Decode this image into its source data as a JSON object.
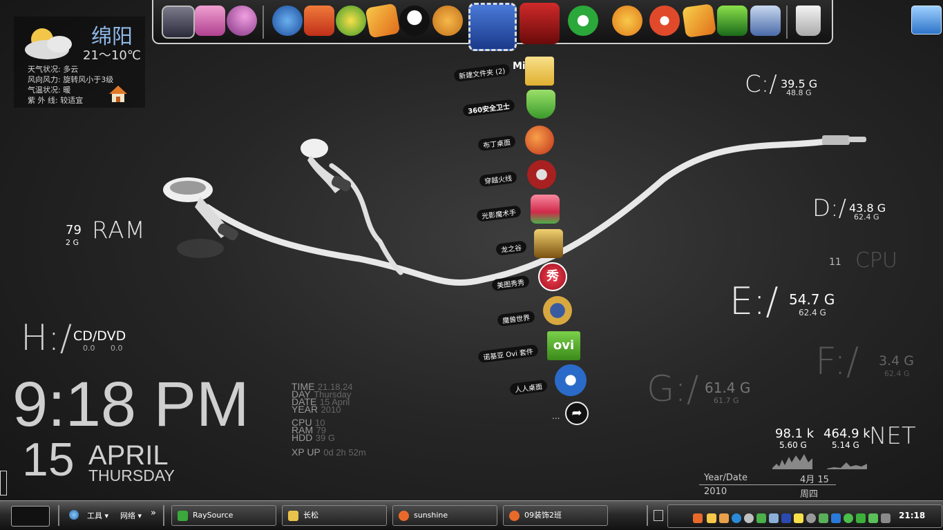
{
  "weather": {
    "city": "绵阳",
    "temp_range": "21～10℃",
    "lines": [
      "天气状况: 多云",
      "风向风力: 旋转风小于3级",
      "气温状况: 暖",
      "紫 外 线: 较适宜"
    ]
  },
  "dock": {
    "icons": [
      "monitor-icon",
      "folder-pink-icon",
      "monitor-ball-icon",
      "network-icon",
      "flash-icon",
      "music-green-icon",
      "music-box-icon",
      "qq-penguin-icon",
      "raccoon-icon",
      "film-strip-icon",
      "torii-gate-icon",
      "ie-browser-icon",
      "arrow-orange-icon",
      "player-red-icon",
      "music-box2-icon",
      "audio-wave-icon",
      "media-player-icon",
      "recycle-bin-icon"
    ],
    "top_label": "Mi...ing"
  },
  "menu": {
    "items": [
      {
        "label": "新建文件夹 (2)",
        "icon": "folder-icon",
        "color": "#e8c24a"
      },
      {
        "label": "360安全卫士",
        "icon": "shield-icon",
        "color": "#5ab53a"
      },
      {
        "label": "布丁桌面",
        "icon": "bird-icon",
        "color": "#d84a1c"
      },
      {
        "label": "穿越火线",
        "icon": "crossfire-icon",
        "color": "#a82020"
      },
      {
        "label": "光影魔术手",
        "icon": "photo-icon",
        "color": "#e05060"
      },
      {
        "label": "龙之谷",
        "icon": "dragon-nest-icon",
        "color": "#c89a30"
      },
      {
        "label": "美图秀秀",
        "icon": "meitu-icon",
        "color": "#d8202c"
      },
      {
        "label": "魔兽世界",
        "icon": "wow-icon",
        "color": "#b88a2a"
      },
      {
        "label": "诺基亚 Ovi 套件",
        "icon": "ovi-icon",
        "color": "#5aa830"
      },
      {
        "label": "人人桌面",
        "icon": "renren-icon",
        "color": "#2a6ac8"
      }
    ],
    "more": "...",
    "ovi_text": "ovi",
    "meitu_text": "秀"
  },
  "ram": {
    "value": "79",
    "size": "2 G",
    "label": "RAM"
  },
  "cddvd": {
    "letter": "H:/",
    "label": "CD/DVD",
    "v1": "0.0",
    "v2": "0.0"
  },
  "drives": {
    "c": {
      "letter": "C:/",
      "free": "39.5 G",
      "total": "48.8 G"
    },
    "d": {
      "letter": "D:/",
      "free": "43.8 G",
      "total": "62.4 G"
    },
    "e": {
      "letter": "E:/",
      "free": "54.7 G",
      "total": "62.4 G"
    },
    "f": {
      "letter": "F:/",
      "free": "3.4 G",
      "total": "62.4 G"
    },
    "g": {
      "letter": "G:/",
      "free": "61.4 G",
      "total": "61.7 G"
    }
  },
  "cpu": {
    "value": "11",
    "label": "CPU"
  },
  "net": {
    "down": "98.1 k",
    "up": "464.9 k",
    "down_total": "5.60 G",
    "up_total": "5.14 G",
    "label": "NET"
  },
  "clock": {
    "time": "9:18 PM",
    "day": "15",
    "month": "APRIL",
    "weekday": "THURSDAY"
  },
  "info": {
    "rows": [
      {
        "k": "TIME",
        "v": "21.18.24"
      },
      {
        "k": "DAY",
        "v": "Thursday"
      },
      {
        "k": "DATE",
        "v": "15 April"
      },
      {
        "k": "YEAR",
        "v": "2010"
      },
      {
        "k": "CPU",
        "v": "10"
      },
      {
        "k": "RAM",
        "v": "79"
      },
      {
        "k": "HDD",
        "v": "39 G"
      },
      {
        "k": "XP UP",
        "v": "0d 2h 52m"
      }
    ]
  },
  "calendar": {
    "label1": "Year/Date",
    "date": "4月 15",
    "year": "2010",
    "weekday": "周四"
  },
  "taskbar": {
    "toolbar1": "工具",
    "toolbar2": "网络",
    "chevrons": "»",
    "tasks": [
      {
        "label": "RaySource",
        "icon": "raysource-icon",
        "color": "#3aa83a"
      },
      {
        "label": "长松",
        "icon": "folder-icon",
        "color": "#e8c24a"
      },
      {
        "label": "sunshine",
        "icon": "qq-group-icon",
        "color": "#e86a2a"
      },
      {
        "label": "09装饰2班",
        "icon": "qq-group-icon",
        "color": "#e86a2a"
      }
    ],
    "clock": "21:18"
  }
}
